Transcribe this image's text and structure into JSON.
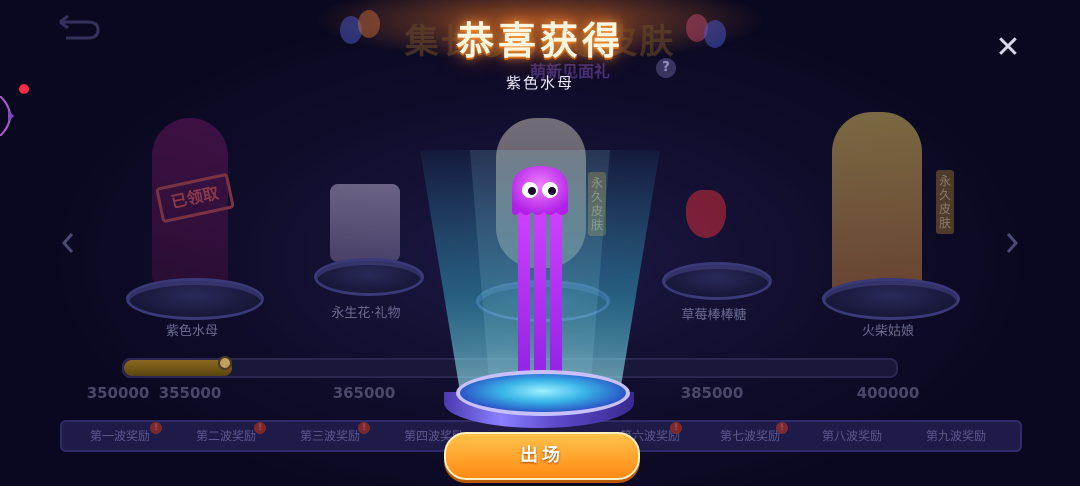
{
  "background": {
    "title": "集长●●●●皮肤",
    "subtitle": "萌新见面礼",
    "rewards": [
      {
        "label": "紫色水母",
        "claimed": true,
        "stamp": "已领取"
      },
      {
        "label": "永生花·礼物",
        "claimed": false
      },
      {
        "label": "",
        "claimed": false,
        "tag": "永久皮肤"
      },
      {
        "label": "草莓棒棒糖",
        "claimed": false
      },
      {
        "label": "火柴姑娘",
        "claimed": false,
        "tag": "永久皮肤"
      }
    ],
    "progress": {
      "fraction": 0.14,
      "milestones": [
        "350000",
        "355000",
        "365000",
        "385000",
        "400000"
      ]
    },
    "tabs": [
      "第一波奖励",
      "第二波奖励",
      "第三波奖励",
      "第四波奖励",
      "第六波奖励",
      "第七波奖励",
      "第八波奖励",
      "第九波奖励"
    ],
    "tab_badge": "!"
  },
  "overlay": {
    "title": "恭喜获得",
    "prize_name": "紫色水母",
    "help_icon": "?",
    "close_icon": "✕",
    "action_button": "出场"
  },
  "icons": {
    "back": "back-arrow-icon",
    "left": "chevron-left-icon",
    "right": "chevron-right-icon",
    "close": "close-icon",
    "help": "help-icon"
  },
  "colors": {
    "accent_orange": "#ff9a1e",
    "jellyfish_purple": "#d030ff",
    "background": "#0d0a26"
  }
}
